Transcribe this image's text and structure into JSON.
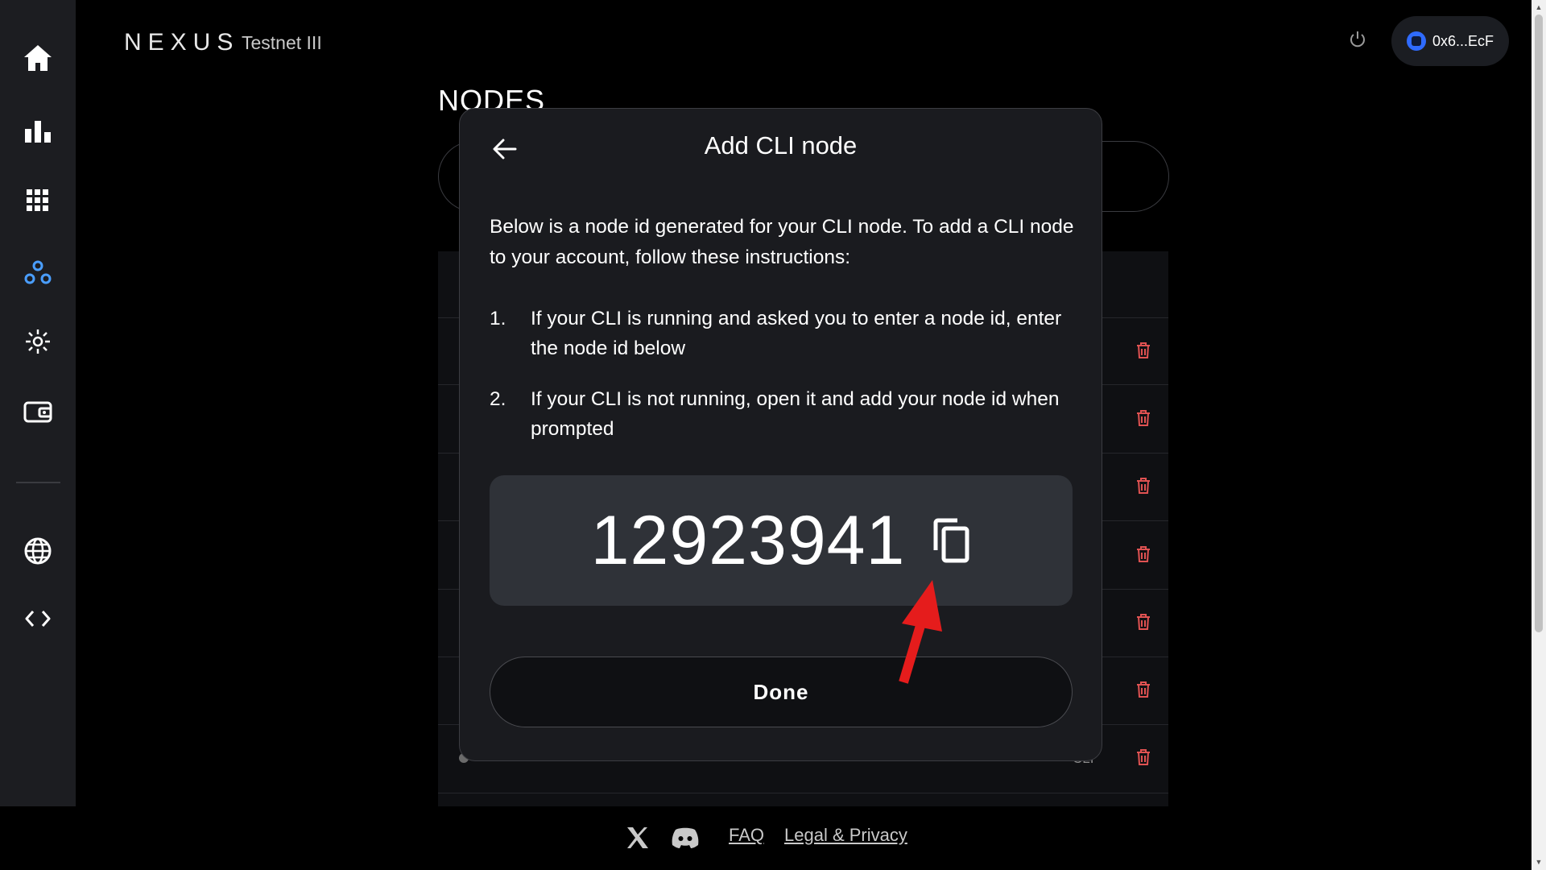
{
  "header": {
    "brand": "NEXUS",
    "network": "Testnet III",
    "wallet_label": "0x6...EcF"
  },
  "sidebar": {
    "items": [
      {
        "name": "home",
        "icon": "home-icon"
      },
      {
        "name": "stats",
        "icon": "bar-chart-icon"
      },
      {
        "name": "apps",
        "icon": "grid-icon"
      },
      {
        "name": "nodes",
        "icon": "nodes-icon",
        "active": true
      },
      {
        "name": "network",
        "icon": "network-icon"
      },
      {
        "name": "wallet",
        "icon": "wallet-icon"
      },
      {
        "name": "explorer",
        "icon": "globe-icon"
      },
      {
        "name": "developers",
        "icon": "code-icon"
      }
    ]
  },
  "page": {
    "title": "NODES",
    "row_label_partial": "CLI"
  },
  "modal": {
    "title": "Add CLI node",
    "intro": "Below is a node id generated for your CLI node. To add a CLI node to your account, follow these instructions:",
    "steps": [
      {
        "num": "1.",
        "text": "If your CLI is running and asked you to enter a node id, enter the node id below"
      },
      {
        "num": "2.",
        "text": "If your CLI is not running, open it and add your node id when prompted"
      }
    ],
    "node_id": "12923941",
    "done_label": "Done"
  },
  "footer": {
    "faq": "FAQ",
    "legal": "Legal & Privacy"
  },
  "colors": {
    "accent": "#2f6bff",
    "active_icon": "#4a9eff",
    "danger": "#e05252",
    "annotation": "#e51c1c"
  }
}
